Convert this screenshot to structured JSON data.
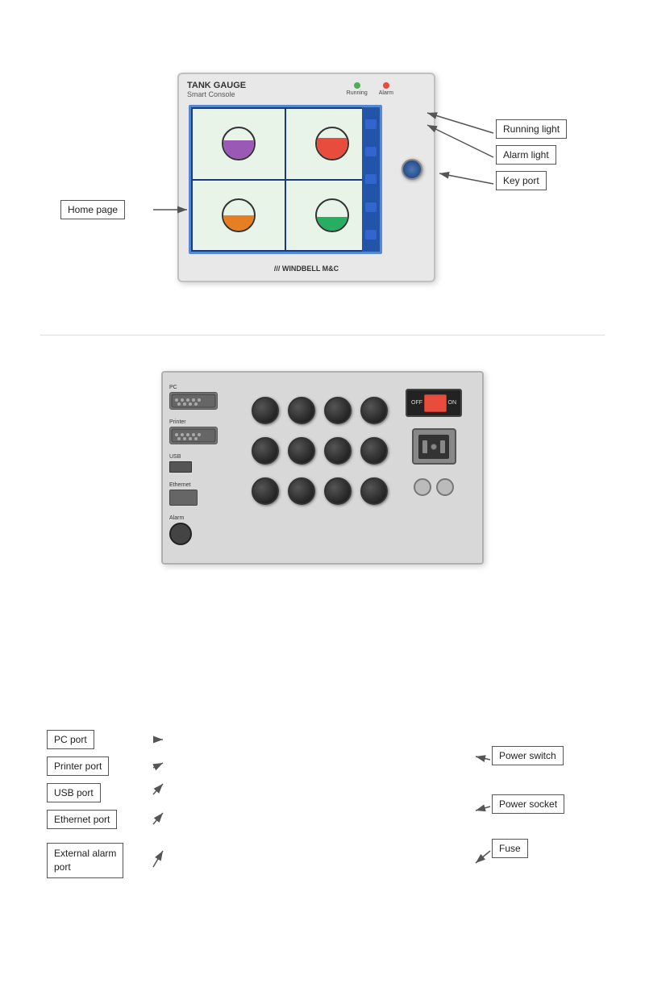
{
  "top": {
    "panel": {
      "title": "TANK GAUGE",
      "subtitle": "Smart Console",
      "brand": "/// WINDBELL M&C",
      "indicators": [
        {
          "label": "Running",
          "color": "green"
        },
        {
          "label": "Alarm",
          "color": "red"
        }
      ]
    },
    "labels": {
      "running_light": "Running light",
      "alarm_light": "Alarm light",
      "key_port": "Key port",
      "home_page": "Home page"
    }
  },
  "bottom": {
    "panel": {
      "port_labels": {
        "pc": "PC",
        "printer": "Printer",
        "usb": "USB",
        "ethernet": "Ethernet",
        "alarm": "Alarm"
      },
      "switch_labels": {
        "off": "OFF",
        "on": "ON"
      }
    },
    "labels": {
      "pc_port": "PC port",
      "printer_port": "Printer port",
      "usb_port": "USB port",
      "ethernet_port": "Ethernet port",
      "external_alarm_port": "External alarm\nport",
      "power_switch": "Power switch",
      "power_socket": "Power socket",
      "fuse": "Fuse"
    }
  }
}
